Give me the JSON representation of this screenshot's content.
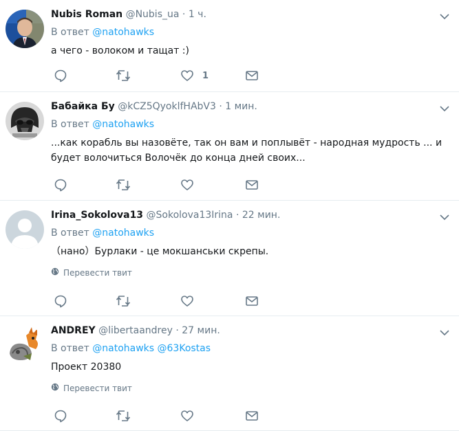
{
  "colors": {
    "link": "#1da1f2",
    "secondary_text": "#657786",
    "primary_text": "#14171a",
    "divider": "#e6ecf0"
  },
  "icons": {
    "reply": "reply-icon",
    "retweet": "retweet-icon",
    "like": "heart-icon",
    "dm": "envelope-icon",
    "more": "chevron-down-icon",
    "translate": "globe-icon"
  },
  "tweets": [
    {
      "name": "Nubis Roman",
      "handle": "@Nubis_ua",
      "separator": "·",
      "time": "1 ч.",
      "reply_prefix": "В ответ",
      "reply_to": [
        "@natohawks"
      ],
      "text": "а чего - волоком и тащат :)",
      "likes": "1"
    },
    {
      "name": "Бабайка Бу",
      "handle": "@kCZ5QyoklfHAbV3",
      "separator": "·",
      "time": "1 мин.",
      "reply_prefix": "В ответ",
      "reply_to": [
        "@natohawks"
      ],
      "text": "...как корабль вы назовёте, так он вам и поплывёт - народная мудрость ...  и\nбудет волочиться Волочёк до конца дней своих..."
    },
    {
      "name": "Irina_Sokolova13",
      "handle": "@Sokolova13Irina",
      "separator": "·",
      "time": "22 мин.",
      "reply_prefix": "В ответ",
      "reply_to": [
        "@natohawks"
      ],
      "text": "（нано）Бурлаки - це мокшанськи скрепы.",
      "translate": "Перевести твит"
    },
    {
      "name": "ANDREY",
      "handle": "@libertaandrey",
      "separator": "·",
      "time": "27 мин.",
      "reply_prefix": "В ответ",
      "reply_to": [
        "@natohawks",
        "@63Kostas"
      ],
      "text": "Проект 20380",
      "translate": "Перевести твит"
    }
  ]
}
